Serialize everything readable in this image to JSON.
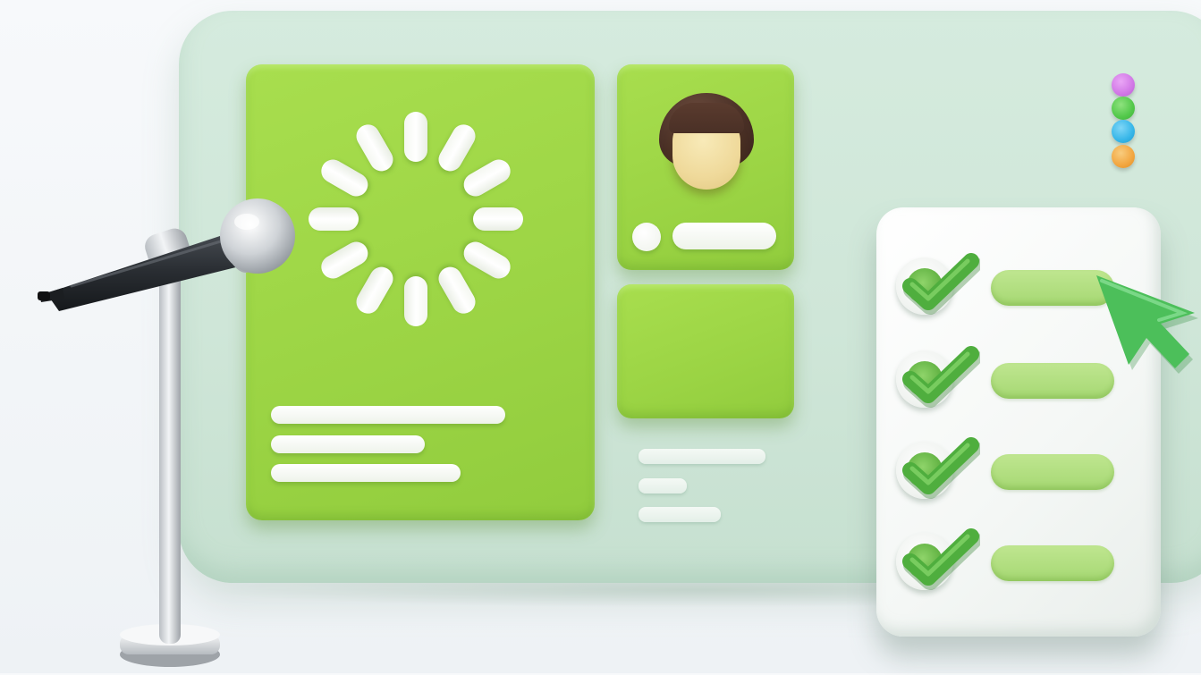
{
  "illustration": {
    "subject": "3d-dashboard-with-microphone-and-checklist",
    "spinner_spokes": 12,
    "colors": {
      "panel_green": "#9fd646",
      "board_mint": "#d0e8da",
      "check_green": "#5cae3e",
      "hair": "#4a3026",
      "skin": "#efd99a"
    },
    "status_dots": [
      {
        "name": "violet-dot",
        "color": "#d178e6"
      },
      {
        "name": "green-dot",
        "color": "#52c84a"
      },
      {
        "name": "blue-dot",
        "color": "#36b6e8"
      },
      {
        "name": "orange-dot",
        "color": "#f2a640"
      }
    ],
    "checklist_items": 4,
    "checked_items": 4,
    "icons": [
      "loading-spinner-icon",
      "avatar-icon",
      "check-icon",
      "cursor-arrow-icon",
      "microphone-icon"
    ]
  }
}
